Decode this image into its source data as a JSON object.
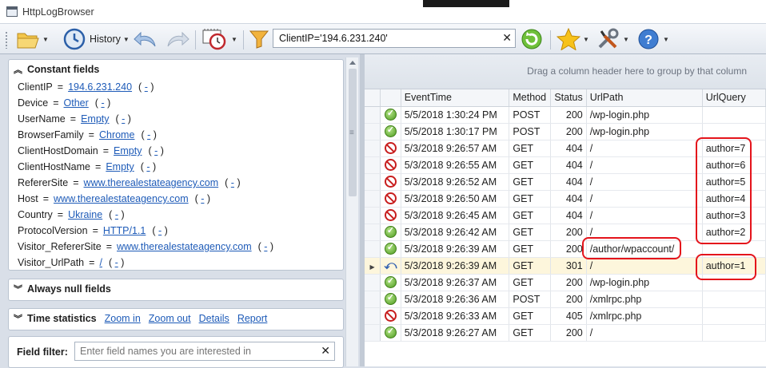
{
  "window": {
    "title": "HttpLogBrowser"
  },
  "toolbar": {
    "history_label": "History",
    "filter_value": "ClientIP='194.6.231.240'",
    "clear_glyph": "✕"
  },
  "constant_fields": {
    "title": "Constant fields",
    "rows": [
      {
        "name": "ClientIP",
        "value": "194.6.231.240"
      },
      {
        "name": "Device",
        "value": "Other"
      },
      {
        "name": "UserName",
        "value": "Empty"
      },
      {
        "name": "BrowserFamily",
        "value": "Chrome"
      },
      {
        "name": "ClientHostDomain",
        "value": "Empty"
      },
      {
        "name": "ClientHostName",
        "value": "Empty"
      },
      {
        "name": "RefererSite",
        "value": "www.therealestateagency.com"
      },
      {
        "name": "Host",
        "value": "www.therealestateagency.com"
      },
      {
        "name": "Country",
        "value": "Ukraine"
      },
      {
        "name": "ProtocolVersion",
        "value": "HTTP/1.1"
      },
      {
        "name": "Visitor_RefererSite",
        "value": "www.therealestateagency.com"
      },
      {
        "name": "Visitor_UrlPath",
        "value": "/"
      }
    ]
  },
  "always_null": {
    "title": "Always null fields"
  },
  "time_stats": {
    "title": "Time statistics",
    "links": [
      "Zoom in",
      "Zoom out",
      "Details",
      "Report"
    ]
  },
  "field_filter": {
    "label": "Field filter:",
    "placeholder": "Enter field names you are interested in"
  },
  "grid": {
    "group_hint": "Drag a column header here to group by that column",
    "columns": [
      "EventTime",
      "Method",
      "Status",
      "UrlPath",
      "UrlQuery"
    ],
    "rows": [
      {
        "icon": "ok",
        "EventTime": "5/5/2018 1:30:24 PM",
        "Method": "POST",
        "Status": "200",
        "UrlPath": "/wp-login.php",
        "UrlQuery": ""
      },
      {
        "icon": "ok",
        "EventTime": "5/5/2018 1:30:17 PM",
        "Method": "POST",
        "Status": "200",
        "UrlPath": "/wp-login.php",
        "UrlQuery": ""
      },
      {
        "icon": "err",
        "EventTime": "5/3/2018 9:26:57 AM",
        "Method": "GET",
        "Status": "404",
        "UrlPath": "/",
        "UrlQuery": "author=7"
      },
      {
        "icon": "err",
        "EventTime": "5/3/2018 9:26:55 AM",
        "Method": "GET",
        "Status": "404",
        "UrlPath": "/",
        "UrlQuery": "author=6"
      },
      {
        "icon": "err",
        "EventTime": "5/3/2018 9:26:52 AM",
        "Method": "GET",
        "Status": "404",
        "UrlPath": "/",
        "UrlQuery": "author=5"
      },
      {
        "icon": "err",
        "EventTime": "5/3/2018 9:26:50 AM",
        "Method": "GET",
        "Status": "404",
        "UrlPath": "/",
        "UrlQuery": "author=4"
      },
      {
        "icon": "err",
        "EventTime": "5/3/2018 9:26:45 AM",
        "Method": "GET",
        "Status": "404",
        "UrlPath": "/",
        "UrlQuery": "author=3"
      },
      {
        "icon": "ok",
        "EventTime": "5/3/2018 9:26:42 AM",
        "Method": "GET",
        "Status": "200",
        "UrlPath": "/",
        "UrlQuery": "author=2"
      },
      {
        "icon": "ok",
        "EventTime": "5/3/2018 9:26:39 AM",
        "Method": "GET",
        "Status": "200",
        "UrlPath": "/author/wpaccount/",
        "UrlQuery": ""
      },
      {
        "icon": "redir",
        "EventTime": "5/3/2018 9:26:39 AM",
        "Method": "GET",
        "Status": "301",
        "UrlPath": "/",
        "UrlQuery": "author=1",
        "selected": true
      },
      {
        "icon": "ok",
        "EventTime": "5/3/2018 9:26:37 AM",
        "Method": "GET",
        "Status": "200",
        "UrlPath": "/wp-login.php",
        "UrlQuery": ""
      },
      {
        "icon": "ok",
        "EventTime": "5/3/2018 9:26:36 AM",
        "Method": "POST",
        "Status": "200",
        "UrlPath": "/xmlrpc.php",
        "UrlQuery": ""
      },
      {
        "icon": "err",
        "EventTime": "5/3/2018 9:26:33 AM",
        "Method": "GET",
        "Status": "405",
        "UrlPath": "/xmlrpc.php",
        "UrlQuery": ""
      },
      {
        "icon": "ok",
        "EventTime": "5/3/2018 9:26:27 AM",
        "Method": "GET",
        "Status": "200",
        "UrlPath": "/",
        "UrlQuery": ""
      }
    ]
  },
  "colors": {
    "link": "#1e5bb8",
    "annotation": "#e4141b",
    "selected_row": "#fdf6dc"
  }
}
